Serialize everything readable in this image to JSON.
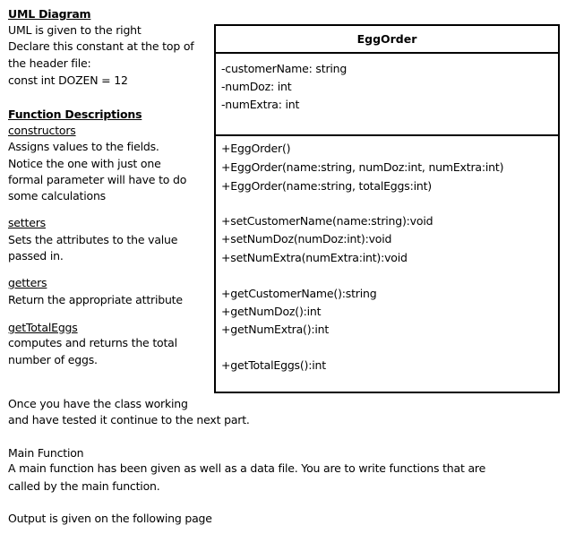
{
  "left": {
    "uml_heading": "UML Diagram",
    "intro": [
      "UML is given to the right",
      "Declare this constant at the top of",
      "the header file:",
      "const int DOZEN = 12"
    ],
    "func_heading": "Function Descriptions",
    "constructors": {
      "title": "constructors",
      "lines": [
        "Assigns values to the fields.",
        "Notice the one with just one",
        "formal parameter will have to do",
        "some calculations"
      ]
    },
    "setters": {
      "title": "setters",
      "lines": [
        "Sets the attributes to the value",
        "passed in."
      ]
    },
    "getters": {
      "title": "getters",
      "lines": [
        "Return the appropriate attribute"
      ]
    },
    "getTotalEggs": {
      "title": "getTotalEggs",
      "lines": [
        "computes and returns the total",
        "number of eggs."
      ]
    }
  },
  "uml": {
    "class_name": "EggOrder",
    "attributes": [
      "-customerName: string",
      "-numDoz: int",
      "-numExtra: int"
    ],
    "methods": [
      "+EggOrder()",
      "+EggOrder(name:string,  numDoz:int, numExtra:int)",
      "+EggOrder(name:string,  totalEggs:int)",
      "+setCustomerName(name:string):void",
      "+setNumDoz(numDoz:int):void",
      "+setNumExtra(numExtra:int):void",
      "+getCustomerName():string",
      "+getNumDoz():int",
      "+getNumExtra():int",
      "+getTotalEggs():int"
    ]
  },
  "bottom": {
    "once": [
      "Once you have the class working",
      "and have tested it continue to the next part."
    ],
    "main_title": "Main Function",
    "main": [
      "A main function has been given as well as a data file. You are to write functions that are",
      "called by the main function."
    ],
    "output": "Output is given on the following page"
  }
}
